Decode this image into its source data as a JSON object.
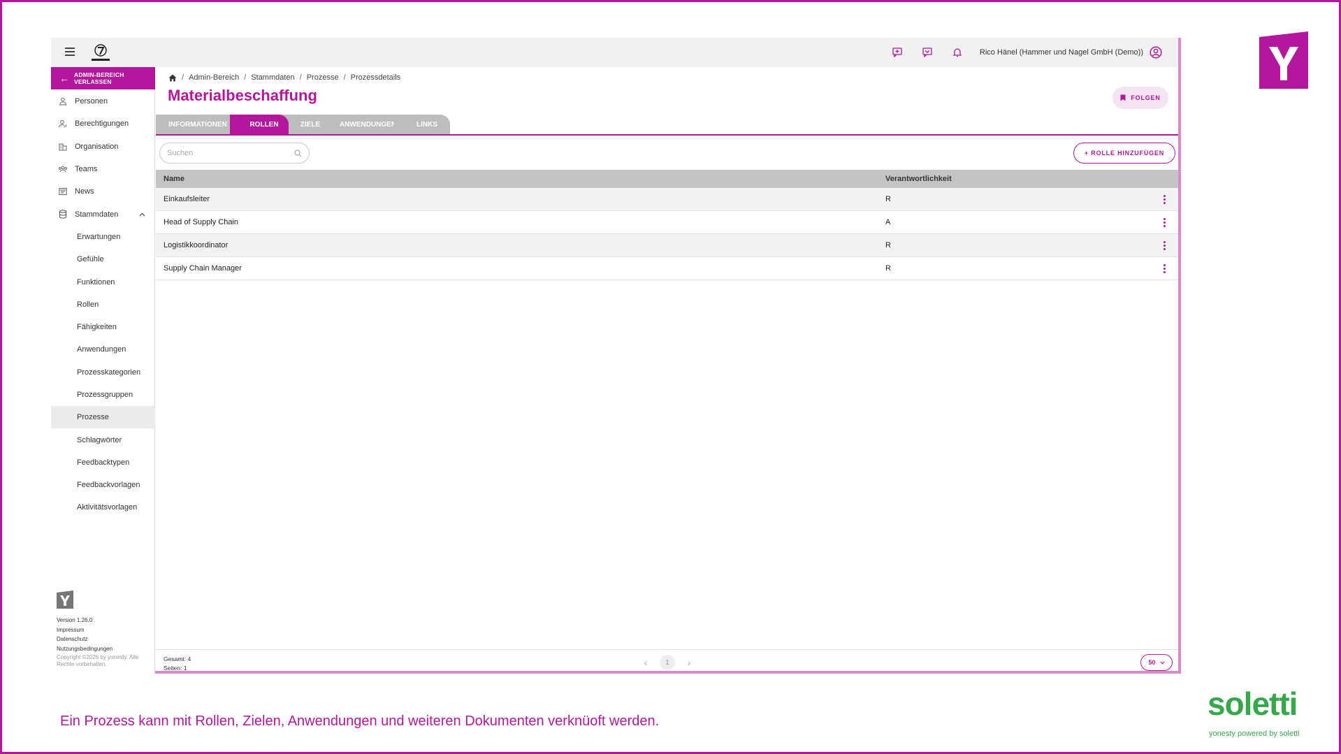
{
  "colors": {
    "accent": "#b3179e",
    "brand_green": "#36a84a"
  },
  "topbar": {
    "user_name": "Rico Hänel (Hammer und Nagel GmbH (Demo))",
    "icons": [
      "hamburger-icon",
      "feedback-add-icon",
      "feedback-inbox-icon",
      "bell-icon",
      "account-circle-icon"
    ]
  },
  "sidebar": {
    "exit_label": "ADMIN-BEREICH\nVERLASSEN",
    "items": [
      {
        "label": "Personen",
        "icon": "person-icon"
      },
      {
        "label": "Berechtigungen",
        "icon": "permissions-icon"
      },
      {
        "label": "Organisation",
        "icon": "organisation-icon"
      },
      {
        "label": "Teams",
        "icon": "teams-icon"
      },
      {
        "label": "News",
        "icon": "news-icon"
      },
      {
        "label": "Stammdaten",
        "icon": "database-icon"
      }
    ],
    "sub_items": [
      "Erwartungen",
      "Gefühle",
      "Funktionen",
      "Rollen",
      "Fähigkeiten",
      "Anwendungen",
      "Prozesskategorien",
      "Prozessgruppen",
      "Prozesse",
      "Schlagwörter",
      "Feedbacktypen",
      "Feedbackvorlagen",
      "Aktivitätsvorlagen"
    ],
    "active_sub": "Prozesse",
    "footer": {
      "version": "Version 1.26.0",
      "impressum": "Impressum",
      "datenschutz": "Datenschutz",
      "nutzung": "Nutzungsbedingungen",
      "copyright": "Copyright ©2026 by yonesty. Alle Rechte vorbehalten."
    }
  },
  "breadcrumb": [
    "Admin-Bereich",
    "Stammdaten",
    "Prozesse",
    "Prozessdetails"
  ],
  "page_title": "Materialbeschaffung",
  "follow_label": "FOLGEN",
  "tabs": [
    "INFORMATIONEN",
    "ROLLEN",
    "ZIELE",
    "ANWENDUNGEN",
    "LINKS"
  ],
  "active_tab": "ROLLEN",
  "search": {
    "placeholder": "Suchen",
    "value": ""
  },
  "add_role_label": "+ ROLLE HINZUFÜGEN",
  "table": {
    "headers": [
      "Name",
      "Verantwortlichkeit"
    ],
    "rows": [
      {
        "name": "Einkaufsleiter",
        "resp": "R"
      },
      {
        "name": "Head of Supply Chain",
        "resp": "A"
      },
      {
        "name": "Logistikkoordinator",
        "resp": "R"
      },
      {
        "name": "Supply Chain Manager",
        "resp": "R"
      }
    ]
  },
  "footer": {
    "total": "Gesamt: 4",
    "pages": "Seiten: 1",
    "current_page": "1",
    "page_size": "50"
  },
  "caption": "Ein Prozess kann mit Rollen, Zielen, Anwendungen und weiteren Dokumenten verknüoft werden.",
  "soletti": {
    "word": "soletti",
    "sub": "yonesty powered by soletti"
  }
}
